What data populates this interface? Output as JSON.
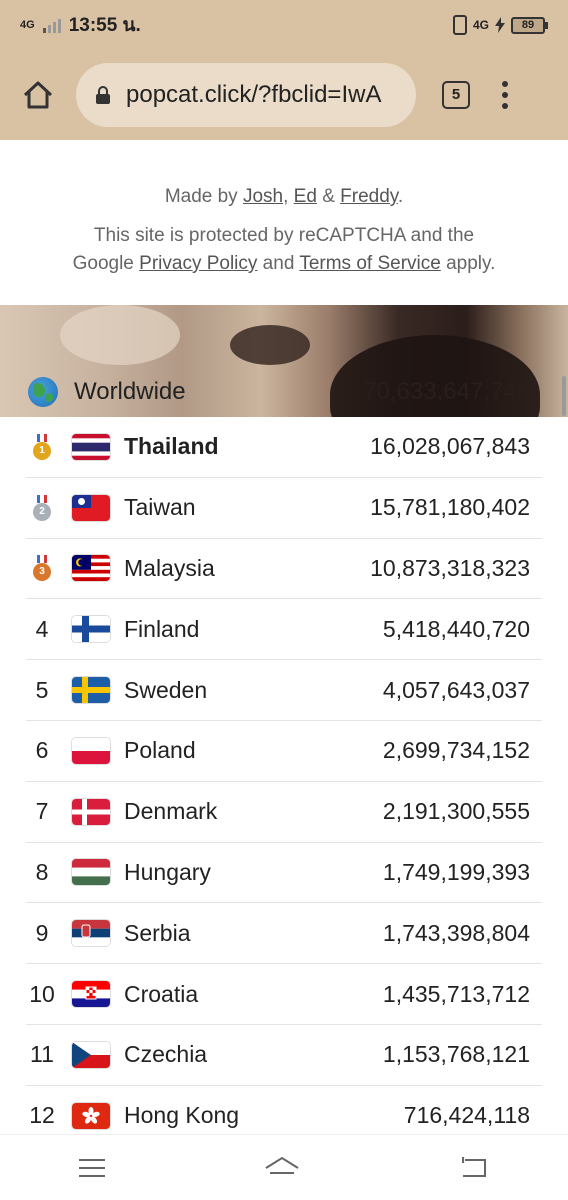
{
  "status_bar": {
    "network": "4G",
    "time": "13:55 น.",
    "network_right": "4G",
    "battery": "89"
  },
  "browser": {
    "url": "popcat.click/?fbclid=IwA",
    "tab_count": "5",
    "icons": [
      "home-icon",
      "lock-icon",
      "tabs-icon",
      "overflow-menu-icon"
    ]
  },
  "credits": {
    "made_by_prefix": "Made by ",
    "author1": "Josh",
    "sep1": ", ",
    "author2": "Ed",
    "sep2": " & ",
    "author3": "Freddy",
    "made_by_suffix": ".",
    "legal_line1": "This site is protected by reCAPTCHA and the",
    "legal_prefix": "Google ",
    "privacy": "Privacy Policy",
    "legal_and": " and ",
    "terms": "Terms of Service",
    "legal_suffix": " apply."
  },
  "worldwide": {
    "label": "Worldwide",
    "value": "70,633,647,746"
  },
  "leaderboard": [
    {
      "rank": "1",
      "country": "Thailand",
      "score": "16,028,067,843"
    },
    {
      "rank": "2",
      "country": "Taiwan",
      "score": "15,781,180,402"
    },
    {
      "rank": "3",
      "country": "Malaysia",
      "score": "10,873,318,323"
    },
    {
      "rank": "4",
      "country": "Finland",
      "score": "5,418,440,720"
    },
    {
      "rank": "5",
      "country": "Sweden",
      "score": "4,057,643,037"
    },
    {
      "rank": "6",
      "country": "Poland",
      "score": "2,699,734,152"
    },
    {
      "rank": "7",
      "country": "Denmark",
      "score": "2,191,300,555"
    },
    {
      "rank": "8",
      "country": "Hungary",
      "score": "1,749,199,393"
    },
    {
      "rank": "9",
      "country": "Serbia",
      "score": "1,743,398,804"
    },
    {
      "rank": "10",
      "country": "Croatia",
      "score": "1,435,713,712"
    },
    {
      "rank": "11",
      "country": "Czechia",
      "score": "1,153,768,121"
    },
    {
      "rank": "12",
      "country": "Hong Kong",
      "score": "716,424,118"
    }
  ],
  "colors": {
    "browser_chrome": "#d9c2a4",
    "gold": "#e3a51c",
    "silver": "#a9b0b8",
    "bronze": "#d9782c"
  }
}
